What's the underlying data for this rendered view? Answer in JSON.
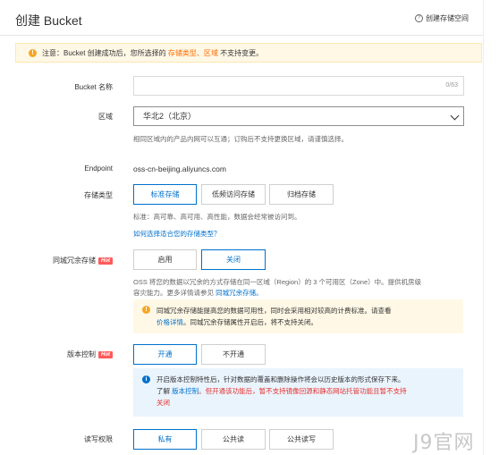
{
  "header": {
    "title": "创建 Bucket",
    "help_label": "创建存储空间"
  },
  "notice": {
    "prefix": "注意：Bucket 创建成功后，您所选择的 ",
    "highlight": "存储类型、区域",
    "suffix": " 不支持变更。"
  },
  "form": {
    "bucket_name": {
      "label": "Bucket 名称",
      "value": "",
      "counter": "0/63"
    },
    "region": {
      "label": "区域",
      "selected": "华北2（北京）",
      "hint": "相同区域内的产品内网可以互通；订购后不支持更换区域，请谨慎选择。"
    },
    "endpoint": {
      "label": "Endpoint",
      "value": "oss-cn-beijing.aliyuncs.com"
    },
    "storage_class": {
      "label": "存储类型",
      "options": [
        "标准存储",
        "低频访问存储",
        "归档存储"
      ],
      "hint": "标准：高可靠、高可用、高性能，数据会经常被访问到。",
      "link": "如何选择适合您的存储类型？"
    },
    "zrs": {
      "label": "同城冗余存储",
      "badge": "Hot",
      "options": [
        "启用",
        "关闭"
      ],
      "desc_line1": "OSS 将您的数据以冗余的方式存储在同一区域（Region）的 3 个可用区（Zone）中。提供机房级",
      "desc_line2_prefix": "容灾能力。更多详情请参见 ",
      "desc_link": "同城冗余存储。",
      "tip_line1": "同城冗余存储能提高您的数据可用性，同时会采用相对较高的计费标准。请查看",
      "tip_link": "价格详情",
      "tip_line2_suffix": "。同城冗余存储属性开启后，将不支持关闭。"
    },
    "versioning": {
      "label": "版本控制",
      "badge": "Hot",
      "options": [
        "开通",
        "不开通"
      ],
      "tip_line1": "开启版本控制特性后，针对数据的覆盖和删除操作将会以历史版本的形式保存下来。",
      "tip_line2_prefix": "了解 ",
      "tip_link": "版本控制",
      "tip_line2_red": "。但开通该功能后，暂不支持镜像回源和静态网站托管功能且暂不支持",
      "tip_line3_red": "关闭"
    },
    "acl": {
      "label": "读写权限",
      "options": [
        "私有",
        "公共读",
        "公共读写"
      ]
    }
  },
  "watermark": "J9官网",
  "colors": {
    "accent": "#0070cc",
    "orange": "#ff6a00",
    "hot": "#ff5a5a",
    "warning_bg": "#fff8e6",
    "info_bg": "#eaf4fd"
  }
}
